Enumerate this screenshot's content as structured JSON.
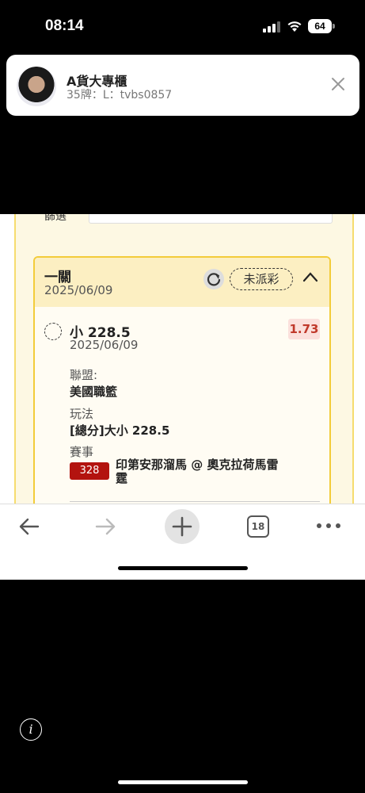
{
  "status_bar": {
    "time": "08:14",
    "battery": "64"
  },
  "notification": {
    "title": "A貨大專櫃",
    "subtitle": "35牌：L：tvbs0857"
  },
  "form": {
    "field_label": "篩選"
  },
  "bet_card": {
    "title": "一關",
    "date": "2025/06/09",
    "status": "未派彩",
    "selection": {
      "name": "小 228.5",
      "date": "2025/06/09",
      "odds": "1.73",
      "league_label": "聯盟:",
      "league": "美國職籃",
      "bet_type_label": "玩法",
      "bet_type": "[總分]大小 228.5",
      "game_label": "賽事",
      "game_id": "328",
      "game_name": "印第安那溜馬 @ 奧克拉荷馬雷霆"
    }
  },
  "toolbar": {
    "tab_count": "18"
  },
  "colors": {
    "accent_yellow": "#f3cc3a",
    "odds_red": "#c0392b",
    "badge_red": "#b3130f"
  }
}
